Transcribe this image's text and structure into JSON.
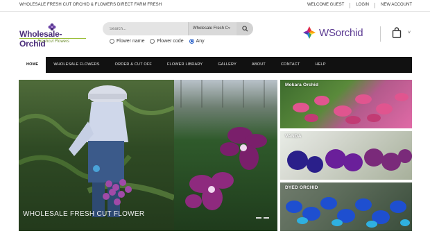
{
  "topbar": {
    "tagline": "WHOLESALE FRESH CUT ORCHID & FLOWERS DIRECT FARM FRESH",
    "welcome": "WELCOME GUEST",
    "login": "LOGIN",
    "new_account": "NEW ACCOUNT"
  },
  "logo": {
    "name": "Wholesale-Orchid",
    "sub": "Freshcut Flowers"
  },
  "search": {
    "placeholder": "Search...",
    "scope": "Wholesale Fresh C▿",
    "icon": "search-icon"
  },
  "search_options": [
    {
      "label": "Flower name",
      "checked": false
    },
    {
      "label": "Flower code",
      "checked": false
    },
    {
      "label": "Any",
      "checked": true
    }
  ],
  "brand2": {
    "name": "WSorchid"
  },
  "cart": {
    "icon": "shopping-bag-icon",
    "caret": "˅"
  },
  "nav": [
    {
      "label": "HOME",
      "active": true
    },
    {
      "label": "WHOLESALE FLOWERS",
      "active": false
    },
    {
      "label": "ORDER & CUT OFF",
      "active": false
    },
    {
      "label": "FLOWER LIBRARY",
      "active": false
    },
    {
      "label": "GALLERY",
      "active": false
    },
    {
      "label": "ABOUT",
      "active": false
    },
    {
      "label": "CONTACT",
      "active": false
    },
    {
      "label": "HELP",
      "active": false
    }
  ],
  "hero": {
    "caption": "WHOLESALE FRESH CUT FLOWER"
  },
  "tiles": [
    {
      "label": "Mokara Orchid"
    },
    {
      "label": "VANDA"
    },
    {
      "label": "DYED ORCHID"
    }
  ],
  "colors": {
    "brand_purple": "#4a2d7a",
    "brand_green": "#6a8b2a",
    "nav_bg": "#111111"
  }
}
